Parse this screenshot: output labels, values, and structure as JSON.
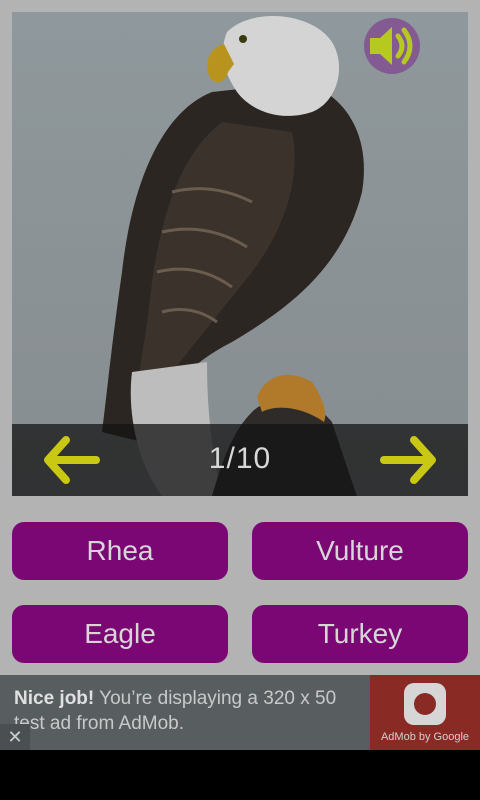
{
  "quiz": {
    "counter": "1/10",
    "answers": [
      "Rhea",
      "Vulture",
      "Eagle",
      "Turkey"
    ]
  },
  "icons": {
    "sound": "speaker-icon",
    "prev": "arrow-left-icon",
    "next": "arrow-right-icon"
  },
  "colors": {
    "answer_button": "#7b0775",
    "arrow": "#c9c914",
    "sound_icon": "#b5c91e",
    "sound_glow": "#7a2a8a"
  },
  "ad": {
    "headline": "Nice job!",
    "body": " You’re displaying a 320 x 50 test ad from AdMob.",
    "logo_text": "AdMob by Google",
    "close_label": "✕"
  }
}
